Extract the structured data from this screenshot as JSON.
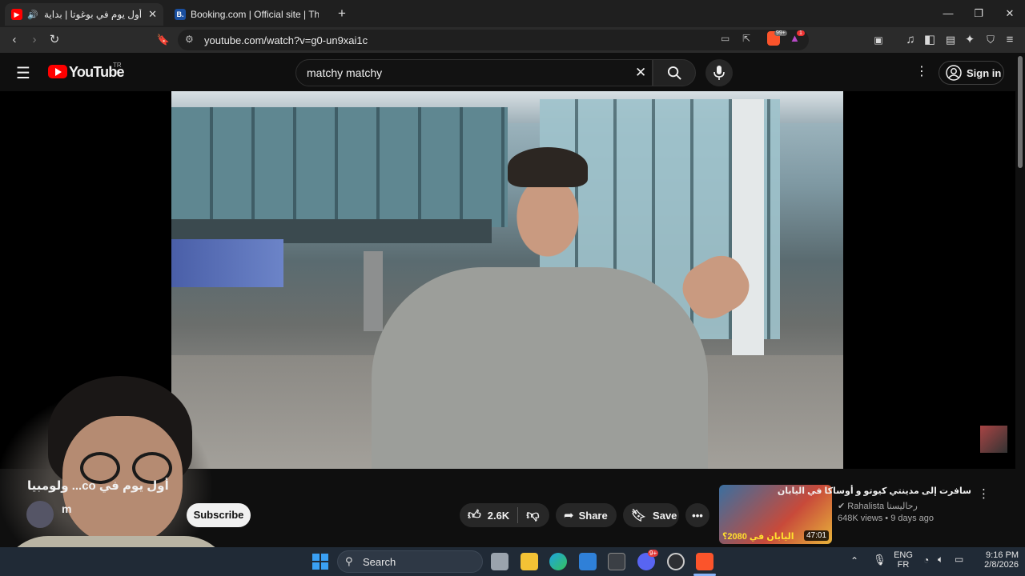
{
  "browser": {
    "tabs": [
      {
        "title": "أول يوم في بوغوتا | بداية رحلتي",
        "active": true,
        "favicon": "youtube-icon"
      },
      {
        "title": "Booking.com | Official site | The best",
        "active": false,
        "favicon": "booking-icon"
      }
    ],
    "new_tab": "+",
    "url": "youtube.com/watch?v=g0-un9xai1c",
    "brave_badge": "99+",
    "rewards_badge": "1"
  },
  "youtube": {
    "logo_text": "YouTube",
    "country": "TR",
    "search_value": "matchy matchy",
    "sign_in": "Sign in"
  },
  "video": {
    "title": "أول يوم في co... ولومبيا",
    "channel_partial": "m",
    "subscribe": "Subscribe",
    "likes": "2.6K",
    "share": "Share",
    "save": "Save"
  },
  "recommended": {
    "title": "سافرت إلى مدينتي كيوتو و أوساكا في اليابان",
    "channel": "Rahalista رحاليستا",
    "meta": "648K views • 9 days ago",
    "duration": "47:01",
    "thumb_text": "اليابان في 2080؟"
  },
  "taskbar": {
    "search": "Search",
    "lang_top": "ENG",
    "lang_bottom": "FR",
    "time": "9:16 PM",
    "date": "2/8/2026",
    "discord_badge": "9+"
  },
  "colors": {
    "youtube_red": "#ff0000",
    "brave_orange": "#fb542b",
    "taskbar": "#202a36"
  }
}
